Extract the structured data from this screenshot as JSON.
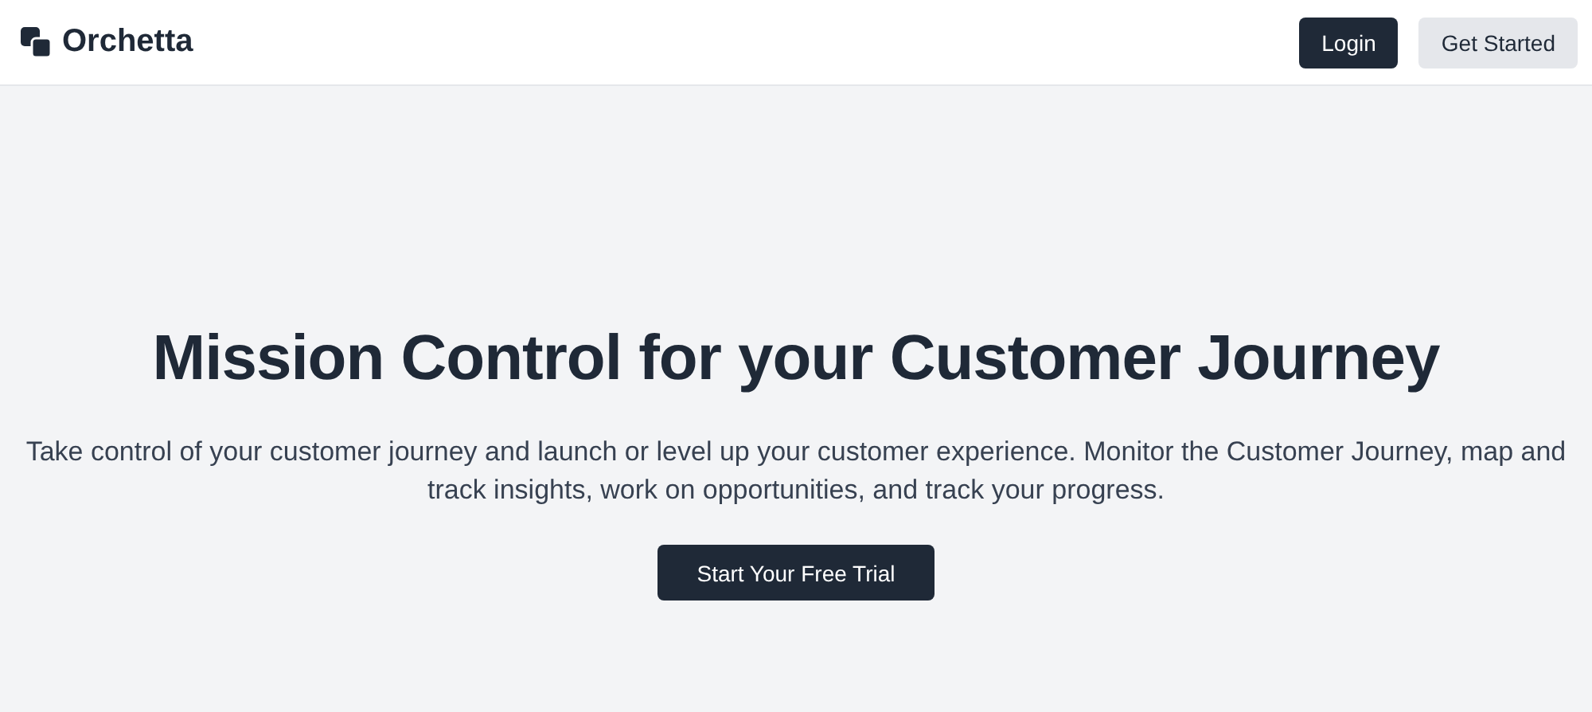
{
  "header": {
    "brand": "Orchetta",
    "buttons": [
      {
        "label": "Login",
        "kind": "primary"
      },
      {
        "label": "Get Started",
        "kind": "secondary"
      }
    ]
  },
  "hero": {
    "title": "Mission Control for your Customer Journey",
    "subtitle": "Take control of your customer journey and launch or level up your customer experience. Monitor the Customer Journey, map and track insights, work on opportunities, and track your progress.",
    "cta": {
      "label": "Start Your Free Trial",
      "kind": "primary"
    }
  }
}
